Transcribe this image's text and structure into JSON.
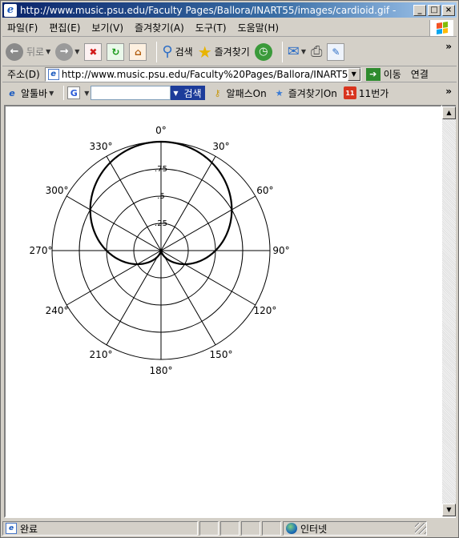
{
  "window": {
    "title": "http://www.music.psu.edu/Faculty Pages/Ballora/INART55/images/cardioid.gif -",
    "minimize": "_",
    "maximize": "□",
    "close": "×"
  },
  "menu": {
    "items": [
      "파일(F)",
      "편집(E)",
      "보기(V)",
      "즐겨찾기(A)",
      "도구(T)",
      "도움말(H)"
    ]
  },
  "toolbar": {
    "back_label": "뒤로",
    "search_label": "검색",
    "favorites_label": "즐겨찾기",
    "chevron": "»"
  },
  "address": {
    "label": "주소(D)",
    "url": "http://www.music.psu.edu/Faculty%20Pages/Ballora/INART55",
    "go_label": "이동",
    "links_label": "연결"
  },
  "altoolbar": {
    "albar_label": "알툴바",
    "search_button": "검색",
    "alpass_label": "알패스On",
    "fav_on_label": "즐겨찾기On",
    "b11_label": "11번가",
    "b11_icon_text": "11",
    "chevron": "»"
  },
  "polar_plot": {
    "angle_labels": [
      "0°",
      "30°",
      "60°",
      "90°",
      "120°",
      "150°",
      "180°",
      "210°",
      "240°",
      "270°",
      "300°",
      "330°"
    ],
    "ring_labels": [
      ".25",
      ".5",
      ".75"
    ]
  },
  "status": {
    "done_text": "완료",
    "zone_text": "인터넷"
  }
}
